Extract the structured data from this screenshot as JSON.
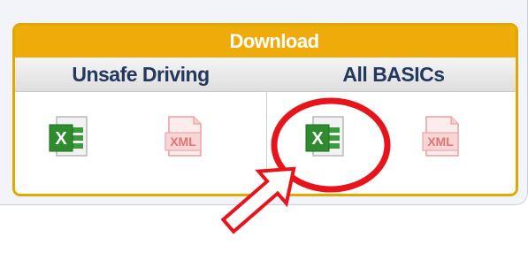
{
  "panel": {
    "title": "Download",
    "columns": [
      {
        "label": "Unsafe Driving",
        "excel_icon": "excel-file-icon",
        "excel_text": "X",
        "xml_icon": "xml-file-icon",
        "xml_text": "XML"
      },
      {
        "label": "All BASICs",
        "excel_icon": "excel-file-icon",
        "excel_text": "X",
        "xml_icon": "xml-file-icon",
        "xml_text": "XML"
      }
    ]
  },
  "colors": {
    "header": "#eeab0a",
    "header_border": "#e0a800",
    "column_text": "#23385f",
    "excel_green": "#2e8b2e",
    "xml_red": "#e57373",
    "annotation_red": "#e8141b"
  },
  "annotation": {
    "highlight_shape": "red-circle",
    "highlight_target": "All BASICs excel download",
    "pointer_icon": "outlined-arrow-icon"
  }
}
